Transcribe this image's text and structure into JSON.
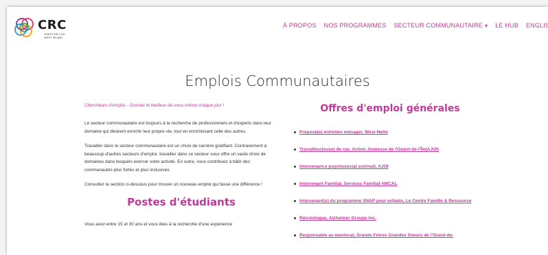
{
  "logo": {
    "name": "CRC",
    "subtitle": "OUEST-DE-L'ÎLE WEST ISLAND"
  },
  "nav": {
    "items": [
      {
        "label": "À PROPOS"
      },
      {
        "label": "NOS PROGRAMMES"
      },
      {
        "label": "SECTEUR COMMUNAUTAIRE",
        "has_dropdown": true
      },
      {
        "label": "LE HUB"
      },
      {
        "label": "ENGLISH"
      }
    ],
    "dropdown_caret": "▾"
  },
  "page": {
    "title": "Emplois Communautaires"
  },
  "left": {
    "tagline": "Chercheurs d'emploi – Donner le meilleur de vous-même chaque jour !",
    "paragraphs": [
      "Le secteur communautaire est toujours à la recherche de professionnels et d'experts dans leur domaine qui désirent enrichir leur propre vie, tout en enrichissant celle des autres.",
      "Travailler dans le secteur communautaire est un choix de carrière gratifiant. Contrairement à beaucoup d'autres secteurs d'emploi, travailler dans ce secteur vous offre un vaste choix de domaines dans lesquels exercer votre activité. En outre, vous contribuez à bâtir des communautés plus fortes et plus inclusives.",
      "Consultez la section ci-dessous pour trouver un nouveau emploi qui fasse une différence !"
    ],
    "students_title": "Postes d'étudiants",
    "students_text": "Vous avez entre 15 et 30 ans et vous êtes à la recherche d'une expérience"
  },
  "right": {
    "title": "Offres d'emploi générales",
    "jobs": [
      "Préposé(e) entretien ménager, West-Nette",
      "Travailleur(euse) de rue, Action Jeunesse de l'Ouest-de-l'Île(AJOI)",
      "Intervenant.e psychosocial soir/nuit, AJOI",
      "Intervenant Familial, Services Familial AMCAL",
      "Intervenant(e) du programme SNAP pour enfants, Le Centre Famille & Ressource",
      "Récréologue, Alzheimer Groupe Inc.",
      "Responsable au mentorat, Grands Frères Grandes Soeurs de l'Ouest-de-"
    ]
  },
  "colors": {
    "accent": "#c2389a",
    "text": "#333333",
    "logo_circles": [
      "#8a3ea0",
      "#e33a7c",
      "#f4a21d",
      "#2aa5d6",
      "#2a9d4a"
    ]
  }
}
